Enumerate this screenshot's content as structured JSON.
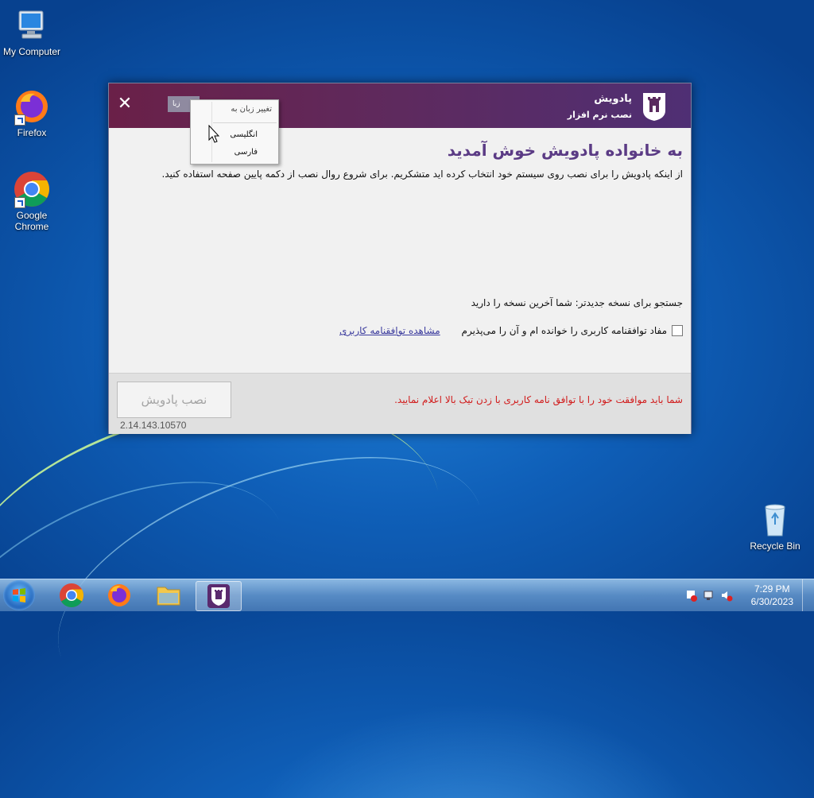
{
  "desktop": {
    "icons": [
      {
        "label": "My Computer"
      },
      {
        "label": "Firefox"
      },
      {
        "label": "Google Chrome"
      },
      {
        "label": "Recycle Bin"
      }
    ]
  },
  "installer": {
    "brand_name": "پادویش",
    "brand_sub": "نصب نرم افزار",
    "language_button": "زبا",
    "welcome_title": "به خانواده پادویش خوش آمدید",
    "intro_text": "از اینکه پادویش را برای نصب روی سیستم خود انتخاب کرده اید متشکریم. برای شروع روال نصب از دکمه پایین صفحه استفاده کنید.",
    "update_check": "جستجو برای نسخه جدیدتر:  شما آخرین نسخه را دارید",
    "agree_label": "مفاد توافقنامه کاربری را خوانده ام و آن را می‌پذیرم",
    "eula_link": "مشاهده توافقنامه کاربری",
    "install_button": "نصب پادویش",
    "warning": "شما باید موافقت خود را با توافق نامه کاربری با زدن تیک بالا اعلام نمایید.",
    "version": "2.14.143.10570"
  },
  "language_menu": {
    "header": "تغییر زبان به",
    "options": [
      "انگلیسی",
      "فارسی"
    ]
  },
  "taskbar": {
    "time": "7:29 PM",
    "date": "6/30/2023"
  },
  "colors": {
    "header_start": "#6a2048",
    "header_end": "#4f2f74",
    "title": "#5b3b85",
    "warning": "#d11c1c"
  }
}
